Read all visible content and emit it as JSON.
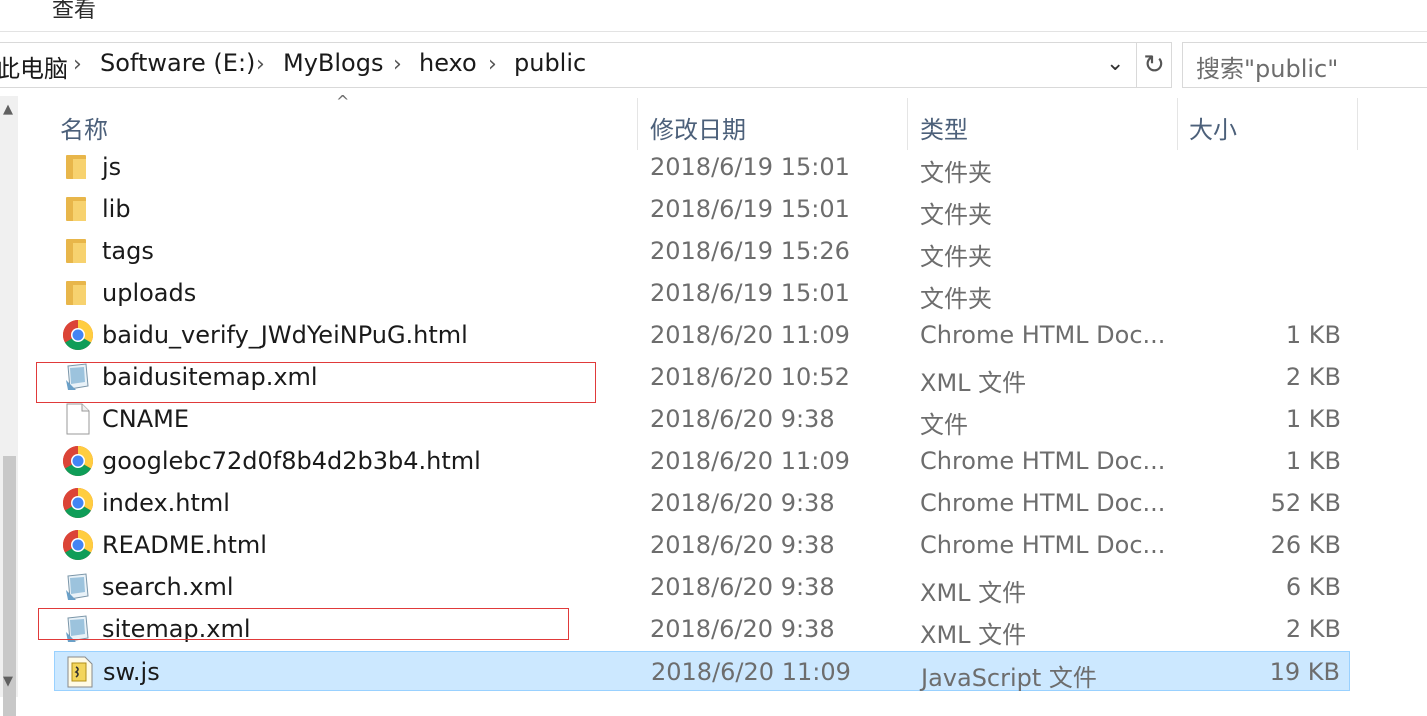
{
  "ribbon": {
    "view_tab": "查看"
  },
  "address": {
    "crumbs": [
      "此电脑",
      "Software (E:)",
      "MyBlogs",
      "hexo",
      "public"
    ],
    "dropdown_glyph": "⌄",
    "refresh_glyph": "↻"
  },
  "search": {
    "placeholder": "搜索\"public\""
  },
  "columns": {
    "name": "名称",
    "date": "修改日期",
    "type": "类型",
    "size": "大小"
  },
  "sort_glyph": "^",
  "files": [
    {
      "icon": "folder-icon",
      "name": "js",
      "date": "2018/6/19 15:01",
      "type": "文件夹",
      "size": ""
    },
    {
      "icon": "folder-icon",
      "name": "lib",
      "date": "2018/6/19 15:01",
      "type": "文件夹",
      "size": ""
    },
    {
      "icon": "folder-icon",
      "name": "tags",
      "date": "2018/6/19 15:26",
      "type": "文件夹",
      "size": ""
    },
    {
      "icon": "folder-icon",
      "name": "uploads",
      "date": "2018/6/19 15:01",
      "type": "文件夹",
      "size": ""
    },
    {
      "icon": "chrome-icon",
      "name": "baidu_verify_JWdYeiNPuG.html",
      "date": "2018/6/20 11:09",
      "type": "Chrome HTML Doc...",
      "size": "1 KB"
    },
    {
      "icon": "xml-icon",
      "name": "baidusitemap.xml",
      "date": "2018/6/20 10:52",
      "type": "XML 文件",
      "size": "2 KB"
    },
    {
      "icon": "file-icon",
      "name": "CNAME",
      "date": "2018/6/20 9:38",
      "type": "文件",
      "size": "1 KB"
    },
    {
      "icon": "chrome-icon",
      "name": "googlebc72d0f8b4d2b3b4.html",
      "date": "2018/6/20 11:09",
      "type": "Chrome HTML Doc...",
      "size": "1 KB"
    },
    {
      "icon": "chrome-icon",
      "name": "index.html",
      "date": "2018/6/20 9:38",
      "type": "Chrome HTML Doc...",
      "size": "52 KB"
    },
    {
      "icon": "chrome-icon",
      "name": "README.html",
      "date": "2018/6/20 9:38",
      "type": "Chrome HTML Doc...",
      "size": "26 KB"
    },
    {
      "icon": "xml-icon",
      "name": "search.xml",
      "date": "2018/6/20 9:38",
      "type": "XML 文件",
      "size": "6 KB"
    },
    {
      "icon": "xml-icon",
      "name": "sitemap.xml",
      "date": "2018/6/20 9:38",
      "type": "XML 文件",
      "size": "2 KB"
    },
    {
      "icon": "js-icon",
      "name": "sw.js",
      "date": "2018/6/20 11:09",
      "type": "JavaScript 文件",
      "size": "19 KB",
      "selected": true
    }
  ],
  "colors": {
    "selection_bg": "#cce8ff",
    "selection_border": "#99d1ff",
    "highlight_border": "#e03a3a",
    "header_text": "#4c607a"
  }
}
